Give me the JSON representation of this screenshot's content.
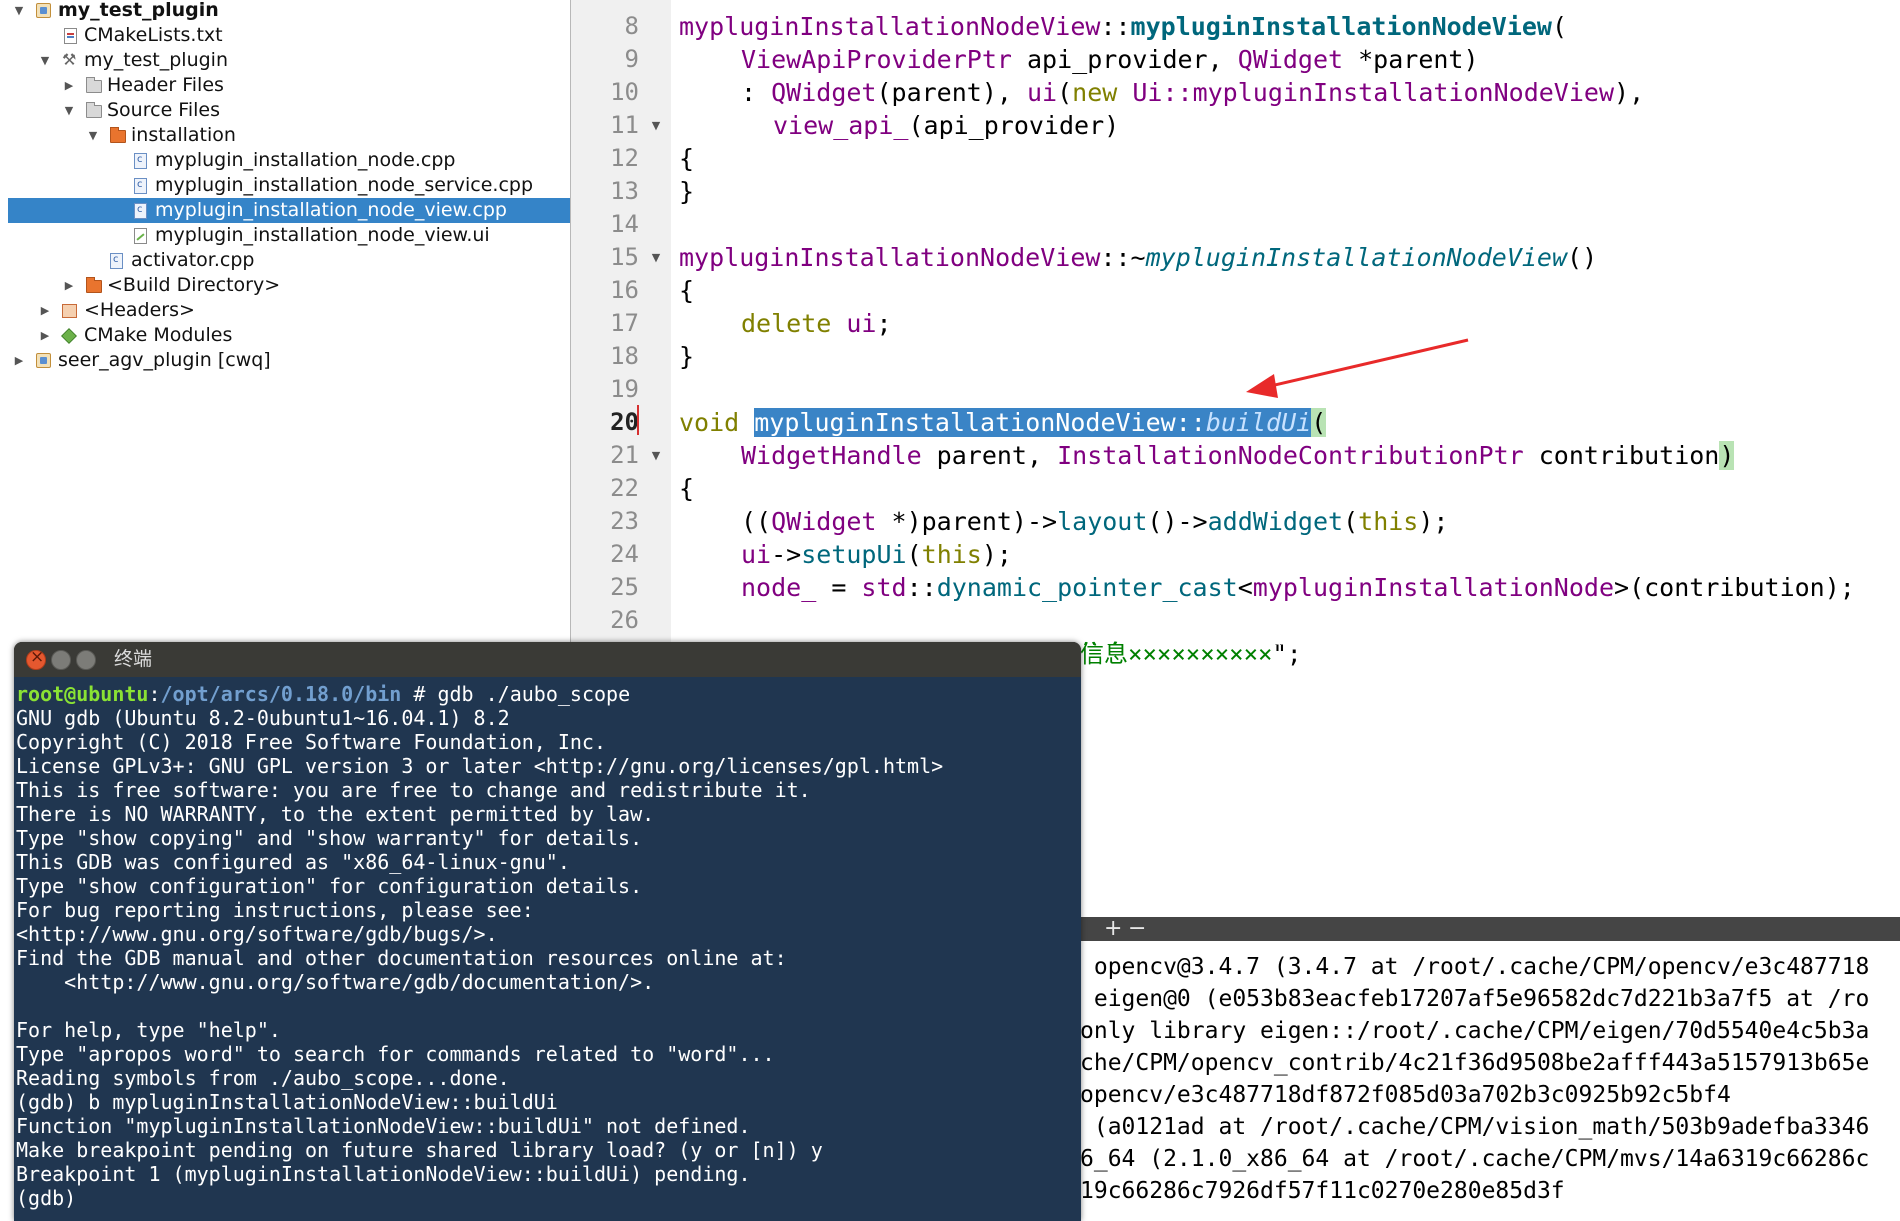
{
  "tree": {
    "items": [
      {
        "label": "my_test_plugin",
        "bold": true
      },
      {
        "label": "CMakeLists.txt"
      },
      {
        "label": "my_test_plugin"
      },
      {
        "label": "Header Files"
      },
      {
        "label": "Source Files"
      },
      {
        "label": "installation"
      },
      {
        "label": "myplugin_installation_node.cpp"
      },
      {
        "label": "myplugin_installation_node_service.cpp"
      },
      {
        "label": "myplugin_installation_node_view.cpp",
        "selected": true
      },
      {
        "label": "myplugin_installation_node_view.ui"
      },
      {
        "label": "activator.cpp"
      },
      {
        "label": "<Build Directory>"
      },
      {
        "label": "<Headers>"
      },
      {
        "label": "CMake Modules"
      },
      {
        "label": "seer_agv_plugin [cwq]"
      }
    ]
  },
  "editor": {
    "current_line": 20,
    "line_numbers": [
      "8",
      "9",
      "10",
      "11",
      "12",
      "13",
      "14",
      "15",
      "16",
      "17",
      "18",
      "19",
      "20",
      "21",
      "22",
      "23",
      "24",
      "25",
      "26"
    ],
    "code": {
      "l8_cls": "mypluginInstallationNodeView",
      "l8_sep": "::",
      "l8_fn": "mypluginInstallationNodeView",
      "l8_par": "(",
      "l9_t1": "ViewApiProviderPtr",
      "l9_a1": " api_provider, ",
      "l9_t2": "QWidget",
      "l9_a2": " *parent)",
      "l10_c": ": ",
      "l10_t1": "QWidget",
      "l10_a1": "(parent), ",
      "l10_m": "ui",
      "l10_p": "(",
      "l10_kw": "new",
      "l10_sp": " ",
      "l10_t2": "Ui::mypluginInstallationNodeView",
      "l10_e": "),",
      "l11_m": "view_api_",
      "l11_a": "(api_provider)",
      "l12": "{",
      "l13": "}",
      "l15_cls": "mypluginInstallationNodeView",
      "l15_sep": "::~",
      "l15_fn": "mypluginInstallationNodeView",
      "l15_par": "()",
      "l16": "{",
      "l17_kw": "delete",
      "l17_sp": " ",
      "l17_m": "ui",
      "l17_e": ";",
      "l18": "}",
      "l20_kw": "void",
      "l20_sp": " ",
      "l20_sel": "mypluginInstallationNodeView::",
      "l20_fn": "buildUi",
      "l20_par": "(",
      "l21_t1": "WidgetHandle",
      "l21_a1": " parent, ",
      "l21_t2": "InstallationNodeContributionPtr",
      "l21_a2": " contribution",
      "l21_par": ")",
      "l22": "{",
      "l23_a": "((",
      "l23_t": "QWidget",
      "l23_b": " *)parent)->",
      "l23_f1": "layout",
      "l23_c": "()->",
      "l23_f2": "addWidget",
      "l23_d": "(",
      "l23_kw": "this",
      "l23_e": ");",
      "l24_m": "ui",
      "l24_a": "->",
      "l24_f": "setupUi",
      "l24_b": "(",
      "l24_kw": "this",
      "l24_e": ");",
      "l25_m": "node_",
      "l25_a": " = ",
      "l25_ns": "std",
      "l25_b": "::",
      "l25_f": "dynamic_pointer_cast",
      "l25_c": "<",
      "l25_t": "mypluginInstallationNode",
      "l25_e": ">(contribution);",
      "l27_str": "信息××××××××××",
      "l27_end": "\";"
    }
  },
  "output": {
    "toolbar": {
      "plus": "+",
      "minus": "−"
    },
    "lines": [
      " opencv@3.4.7 (3.4.7 at /root/.cache/CPM/opencv/e3c487718",
      " eigen@0 (e053b83eacfeb17207af5e96582dc7d221b3a7f5 at /ro",
      "only library eigen::/root/.cache/CPM/eigen/70d5540e4c5b3a",
      "che/CPM/opencv_contrib/4c21f36d9508be2afff443a5157913b65e",
      "opencv/e3c487718df872f085d03a702b3c0925b92c5bf4",
      " (a0121ad at /root/.cache/CPM/vision_math/503b9adefba3346",
      "6_64 (2.1.0_x86_64 at /root/.cache/CPM/mvs/14a6319c66286c",
      "19c66286c7926df57f11c0270e280e85d3f"
    ]
  },
  "terminal": {
    "title": "终端",
    "prompt": {
      "user": "root@ubuntu",
      "colon": ":",
      "path": "/opt/arcs/0.18.0/bin",
      "rest": " # gdb ./aubo_scope"
    },
    "lines": [
      "GNU gdb (Ubuntu 8.2-0ubuntu1~16.04.1) 8.2",
      "Copyright (C) 2018 Free Software Foundation, Inc.",
      "License GPLv3+: GNU GPL version 3 or later <http://gnu.org/licenses/gpl.html>",
      "This is free software: you are free to change and redistribute it.",
      "There is NO WARRANTY, to the extent permitted by law.",
      "Type \"show copying\" and \"show warranty\" for details.",
      "This GDB was configured as \"x86_64-linux-gnu\".",
      "Type \"show configuration\" for configuration details.",
      "For bug reporting instructions, please see:",
      "<http://www.gnu.org/software/gdb/bugs/>.",
      "Find the GDB manual and other documentation resources online at:",
      "    <http://www.gnu.org/software/gdb/documentation/>.",
      "",
      "For help, type \"help\".",
      "Type \"apropos word\" to search for commands related to \"word\"...",
      "Reading symbols from ./aubo_scope...done.",
      "(gdb) b mypluginInstallationNodeView::buildUi",
      "Function \"mypluginInstallationNodeView::buildUi\" not defined.",
      "Make breakpoint pending on future shared library load? (y or [n]) y",
      "Breakpoint 1 (mypluginInstallationNodeView::buildUi) pending.",
      "(gdb)"
    ]
  },
  "colors": {
    "selection": "#3a84c6",
    "terminal_bg": "#203650",
    "annotation_arrow": "#e82a2a"
  }
}
